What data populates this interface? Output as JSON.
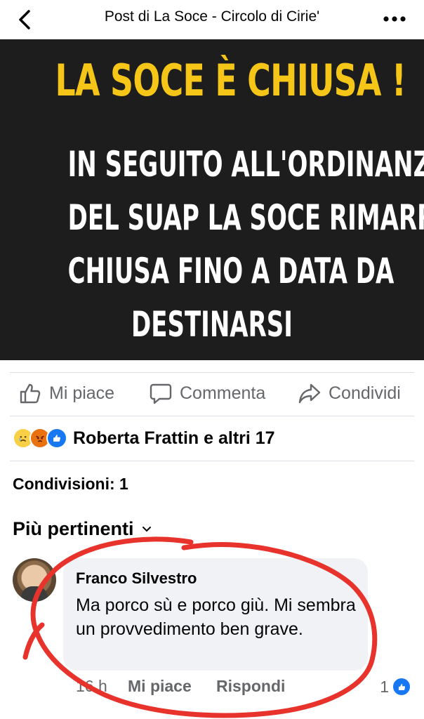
{
  "header": {
    "title": "Post di La Soce - Circolo di Cirie'",
    "back_icon": "chevron-left-icon",
    "more_icon": "more-horizontal-icon"
  },
  "post_image": {
    "headline": "LA SOCE È CHIUSA !",
    "body_lines": [
      "IN SEGUITO ALL'ORDINANZA",
      "DEL SUAP LA SOCE RIMARRÀ",
      "CHIUSA FINO A DATA DA",
      "DESTINARSI"
    ],
    "colors": {
      "background": "#1d1d1d",
      "headline": "#f5c518",
      "body": "#ffffff"
    }
  },
  "actions": {
    "like_label": "Mi piace",
    "comment_label": "Commenta",
    "share_label": "Condividi"
  },
  "reactions": {
    "icons": [
      "sad-face-icon",
      "angry-face-icon",
      "thumbs-up-icon"
    ],
    "summary": "Roberta Frattin e altri 17"
  },
  "shares": {
    "label": "Condivisioni: 1"
  },
  "sort": {
    "label": "Più pertinenti"
  },
  "comment": {
    "author": "Franco Silvestro",
    "text": "Ma porco sù e porco giù. Mi sembra un provvedimento ben grave.",
    "time": "16 h",
    "like_label": "Mi piace",
    "reply_label": "Rispondi",
    "likes_count": "1"
  },
  "colors": {
    "accent_blue": "#1877f2",
    "muted_text": "#65676b",
    "bubble_bg": "#f0f2f5",
    "annotation_red": "#e8322c"
  }
}
